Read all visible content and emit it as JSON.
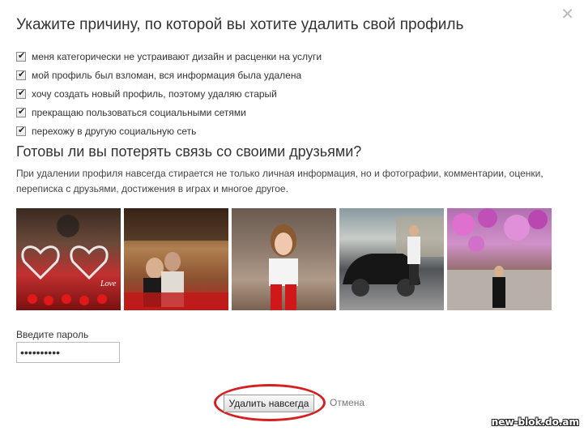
{
  "dialog": {
    "close_icon": "close-icon",
    "title": "Укажите причину, по которой вы хотите удалить свой профиль",
    "reasons": [
      {
        "label": "меня категорически не устраивают дизайн и расценки на услуги",
        "checked": true
      },
      {
        "label": "мой профиль был взломан, вся информация была удалена",
        "checked": true
      },
      {
        "label": "хочу создать новый профиль, поэтому удаляю старый",
        "checked": true
      },
      {
        "label": "прекращаю пользоваться социальными сетями",
        "checked": true
      },
      {
        "label": "перехожу в другую социальную сеть",
        "checked": true
      }
    ],
    "subtitle": "Готовы ли вы потерять связь со своими друзьями?",
    "description": "При удалении профиля навсегда стирается не только личная информация, но и фотографии, комментарии, оценки, переписка с друзьями, достижения в играх и многое другое.",
    "photo_overlay_text": "Love",
    "password_label": "Введите пароль",
    "password_value": "••••••••••",
    "delete_button": "Удалить навсегда",
    "cancel_link": "Отмена"
  },
  "watermark": "new-blok.do.am",
  "colors": {
    "highlight_ring": "#d42020",
    "text": "#333333",
    "cancel": "#777777"
  }
}
